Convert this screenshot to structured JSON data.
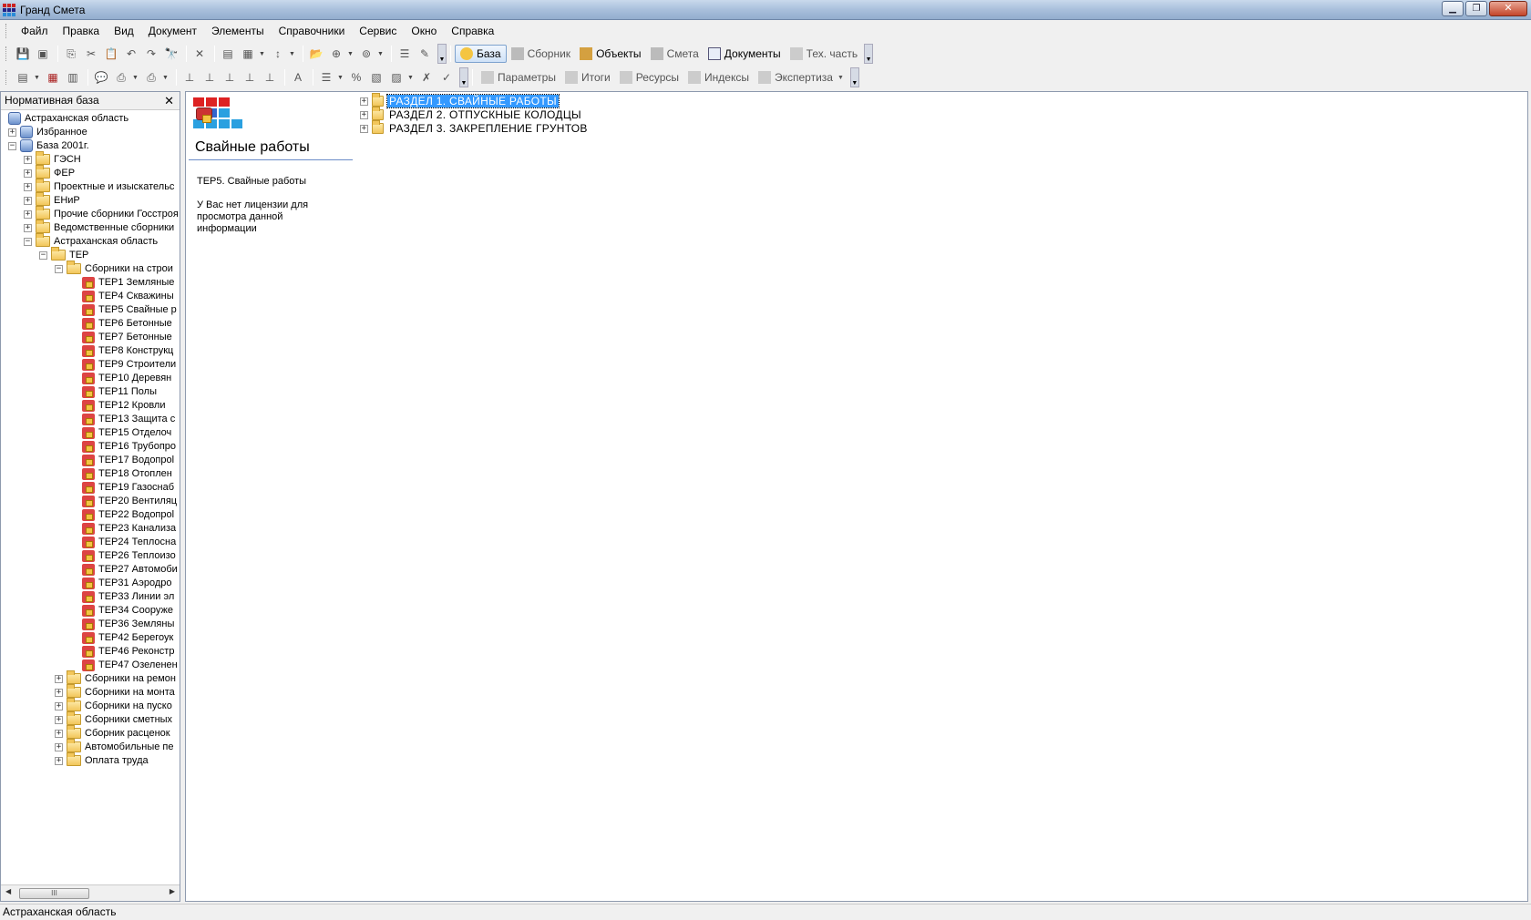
{
  "window": {
    "title": "Гранд Смета",
    "controls": [
      "minimize-icon",
      "restore-icon",
      "close-icon"
    ]
  },
  "menu": [
    "Файл",
    "Правка",
    "Вид",
    "Документ",
    "Элементы",
    "Справочники",
    "Сервис",
    "Окно",
    "Справка"
  ],
  "toolbar1": {
    "modes": [
      {
        "label": "База",
        "active": true
      },
      {
        "label": "Сборник",
        "active": false
      },
      {
        "label": "Объекты",
        "active": false,
        "dark": true
      },
      {
        "label": "Смета",
        "active": false
      },
      {
        "label": "Документы",
        "active": false,
        "dark": true
      },
      {
        "label": "Тех. часть",
        "active": false
      }
    ]
  },
  "toolbar2": {
    "views": [
      "Параметры",
      "Итоги",
      "Ресурсы",
      "Индексы",
      "Экспертиза"
    ]
  },
  "left_pane": {
    "title": "Нормативная база",
    "tree": [
      {
        "label": "Астраханская область",
        "depth": 0,
        "icon": "db",
        "exp": ""
      },
      {
        "label": "Избранное",
        "depth": 1,
        "icon": "db",
        "exp": "+"
      },
      {
        "label": "База 2001г.",
        "depth": 1,
        "icon": "db",
        "exp": "-"
      },
      {
        "label": "ГЭСН",
        "depth": 2,
        "icon": "folder",
        "exp": "+"
      },
      {
        "label": "ФЕР",
        "depth": 2,
        "icon": "folder",
        "exp": "+"
      },
      {
        "label": "Проектные и изыскательс",
        "depth": 2,
        "icon": "folder",
        "exp": "+"
      },
      {
        "label": "ЕНиР",
        "depth": 2,
        "icon": "folder",
        "exp": "+"
      },
      {
        "label": "Прочие сборники Госстроя",
        "depth": 2,
        "icon": "folder",
        "exp": "+"
      },
      {
        "label": "Ведомственные сборники",
        "depth": 2,
        "icon": "folder",
        "exp": "+"
      },
      {
        "label": "Астраханская область",
        "depth": 2,
        "icon": "folder",
        "exp": "-"
      },
      {
        "label": "ТЕР",
        "depth": 3,
        "icon": "folder",
        "exp": "-"
      },
      {
        "label": "Сборники на строи",
        "depth": 4,
        "icon": "folder",
        "exp": "-"
      },
      {
        "label": "ТЕР1 Земляные",
        "depth": 5,
        "icon": "book",
        "exp": ""
      },
      {
        "label": "ТЕР4 Скважины",
        "depth": 5,
        "icon": "book",
        "exp": ""
      },
      {
        "label": "ТЕР5 Свайные р",
        "depth": 5,
        "icon": "book",
        "exp": ""
      },
      {
        "label": "ТЕР6 Бетонные",
        "depth": 5,
        "icon": "book",
        "exp": ""
      },
      {
        "label": "ТЕР7 Бетонные",
        "depth": 5,
        "icon": "book",
        "exp": ""
      },
      {
        "label": "ТЕР8 Конструкц",
        "depth": 5,
        "icon": "book",
        "exp": ""
      },
      {
        "label": "ТЕР9 Строители",
        "depth": 5,
        "icon": "book",
        "exp": ""
      },
      {
        "label": "ТЕР10 Деревян",
        "depth": 5,
        "icon": "book",
        "exp": ""
      },
      {
        "label": "ТЕР11 Полы",
        "depth": 5,
        "icon": "book",
        "exp": ""
      },
      {
        "label": "ТЕР12 Кровли",
        "depth": 5,
        "icon": "book",
        "exp": ""
      },
      {
        "label": "ТЕР13 Защита с",
        "depth": 5,
        "icon": "book",
        "exp": ""
      },
      {
        "label": "ТЕР15 Отделоч",
        "depth": 5,
        "icon": "book",
        "exp": ""
      },
      {
        "label": "ТЕР16 Трубопро",
        "depth": 5,
        "icon": "book",
        "exp": ""
      },
      {
        "label": "ТЕР17 Водопрol",
        "depth": 5,
        "icon": "book",
        "exp": ""
      },
      {
        "label": "ТЕР18 Отоплен",
        "depth": 5,
        "icon": "book",
        "exp": ""
      },
      {
        "label": "ТЕР19 Газоснаб",
        "depth": 5,
        "icon": "book",
        "exp": ""
      },
      {
        "label": "ТЕР20 Вентиляц",
        "depth": 5,
        "icon": "book",
        "exp": ""
      },
      {
        "label": "ТЕР22 Водопрol",
        "depth": 5,
        "icon": "book",
        "exp": ""
      },
      {
        "label": "ТЕР23 Канализа",
        "depth": 5,
        "icon": "book",
        "exp": ""
      },
      {
        "label": "ТЕР24 Теплосна",
        "depth": 5,
        "icon": "book",
        "exp": ""
      },
      {
        "label": "ТЕР26 Теплоизо",
        "depth": 5,
        "icon": "book",
        "exp": ""
      },
      {
        "label": "ТЕР27 Автомоби",
        "depth": 5,
        "icon": "book",
        "exp": ""
      },
      {
        "label": "ТЕР31 Аэродро",
        "depth": 5,
        "icon": "book",
        "exp": ""
      },
      {
        "label": "ТЕР33 Линии эл",
        "depth": 5,
        "icon": "book",
        "exp": ""
      },
      {
        "label": "ТЕР34 Сооруже",
        "depth": 5,
        "icon": "book",
        "exp": ""
      },
      {
        "label": "ТЕР36 Земляны",
        "depth": 5,
        "icon": "book",
        "exp": ""
      },
      {
        "label": "ТЕР42 Берегоук",
        "depth": 5,
        "icon": "book",
        "exp": ""
      },
      {
        "label": "ТЕР46 Реконстр",
        "depth": 5,
        "icon": "book",
        "exp": ""
      },
      {
        "label": "ТЕР47 Озеленен",
        "depth": 5,
        "icon": "book",
        "exp": ""
      },
      {
        "label": "Сборники на ремон",
        "depth": 4,
        "icon": "folder",
        "exp": "+"
      },
      {
        "label": "Сборники на монта",
        "depth": 4,
        "icon": "folder",
        "exp": "+"
      },
      {
        "label": "Сборники на пуско",
        "depth": 4,
        "icon": "folder",
        "exp": "+"
      },
      {
        "label": "Сборники сметных",
        "depth": 4,
        "icon": "folder",
        "exp": "+"
      },
      {
        "label": "Сборник расценок",
        "depth": 4,
        "icon": "folder",
        "exp": "+"
      },
      {
        "label": "Автомобильные пе",
        "depth": 4,
        "icon": "folder",
        "exp": "+"
      },
      {
        "label": "Оплата труда",
        "depth": 4,
        "icon": "folder",
        "exp": "+"
      }
    ],
    "scroll_thumb": "III"
  },
  "info": {
    "title": "Свайные работы",
    "code": "ТЕР5. Свайные работы",
    "message": "У Вас нет лицензии для просмотра данной информации"
  },
  "sections": [
    {
      "label": "РАЗДЕЛ 1. СВАЙНЫЕ РАБОТЫ",
      "selected": true
    },
    {
      "label": "РАЗДЕЛ 2. ОТПУСКНЫЕ КОЛОДЦЫ",
      "selected": false
    },
    {
      "label": "РАЗДЕЛ 3. ЗАКРЕПЛЕНИЕ ГРУНТОВ",
      "selected": false
    }
  ],
  "status": "Астраханская область"
}
